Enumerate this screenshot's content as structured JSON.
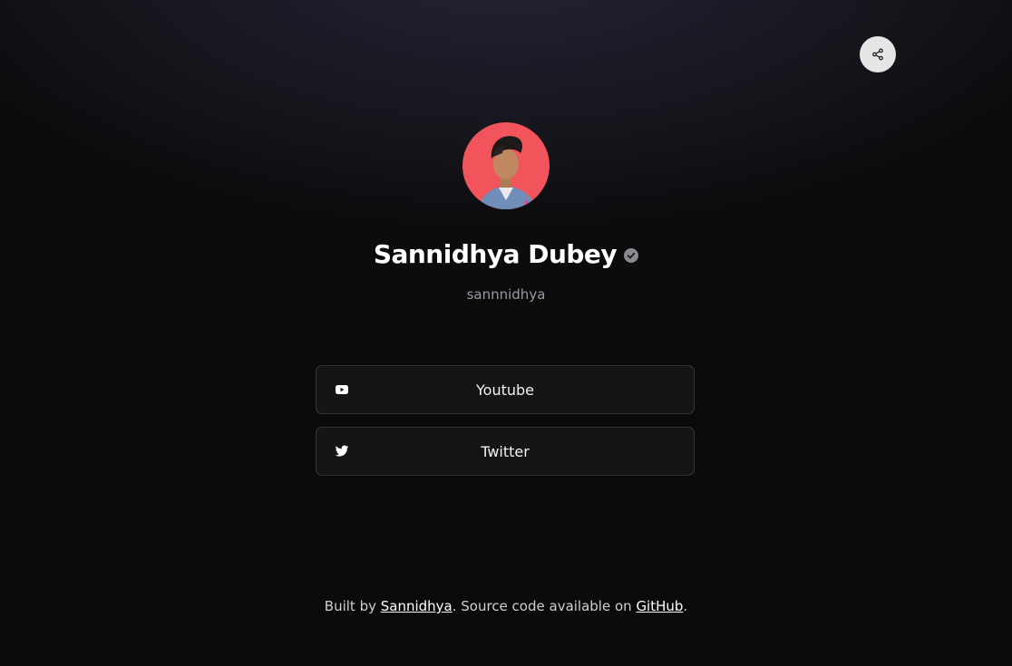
{
  "profile": {
    "name": "Sannidhya Dubey",
    "username": "sannnidhya"
  },
  "links": [
    {
      "label": "Youtube",
      "icon": "youtube-icon"
    },
    {
      "label": "Twitter",
      "icon": "twitter-icon"
    }
  ],
  "share": {
    "icon": "share-icon"
  },
  "footer": {
    "prefix": "Built by ",
    "author_link": "Sannidhya",
    "middle": ". Source code available on ",
    "github_link": "GitHub",
    "suffix": "."
  },
  "colors": {
    "background": "#0b0b0c",
    "avatar_bg": "#f2545b",
    "button_bg": "#151516",
    "button_border": "#34343a",
    "username": "#9a9aa8",
    "share_bg": "#e6e6e6"
  }
}
